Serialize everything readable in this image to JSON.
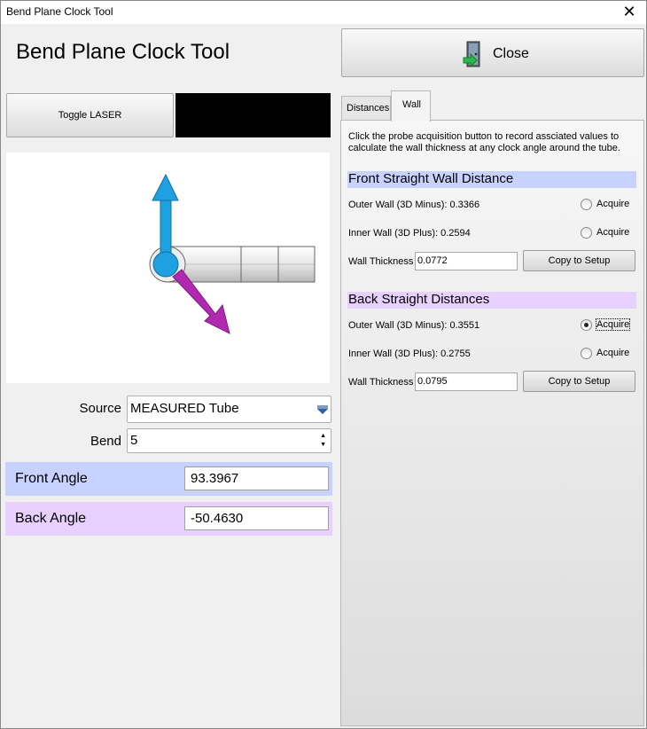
{
  "window": {
    "title": "Bend Plane Clock Tool",
    "close_glyph": "✕"
  },
  "header": {
    "app_title": "Bend Plane Clock Tool",
    "close_label": "Close",
    "close_icon": "door-exit-icon"
  },
  "left": {
    "toggle_label": "Toggle LASER",
    "source_label": "Source",
    "source_value": "MEASURED Tube",
    "bend_label": "Bend",
    "bend_value": "5",
    "front_angle_label": "Front Angle",
    "front_angle_value": "93.3967",
    "back_angle_label": "Back Angle",
    "back_angle_value": "-50.4630"
  },
  "tabs": [
    {
      "label": "Distances"
    },
    {
      "label": "Wall"
    }
  ],
  "wall": {
    "description": "Click the probe acquisition button to record assciated values to calculate the wall thickness at any clock angle around the tube.",
    "front": {
      "title": "Front Straight Wall Distance",
      "outer": "Outer Wall (3D Minus):  0.3366",
      "inner": "Inner Wall (3D Plus):  0.2594",
      "thickness_label": "Wall Thickness",
      "thickness_value": "0.0772",
      "acquire": "Acquire",
      "copy": "Copy to Setup"
    },
    "back": {
      "title": "Back Straight Distances",
      "outer": "Outer Wall (3D Minus):  0.3551",
      "inner": "Inner Wall (3D Plus):  0.2755",
      "thickness_label": "Wall Thickness",
      "thickness_value": "0.0795",
      "acquire": "Acquire",
      "copy": "Copy to Setup"
    }
  },
  "colors": {
    "front_band": "#c8d2ff",
    "back_band": "#e8d0ff",
    "blue_arrow": "#1fa0e0",
    "magenta_arrow": "#b02ab0"
  }
}
